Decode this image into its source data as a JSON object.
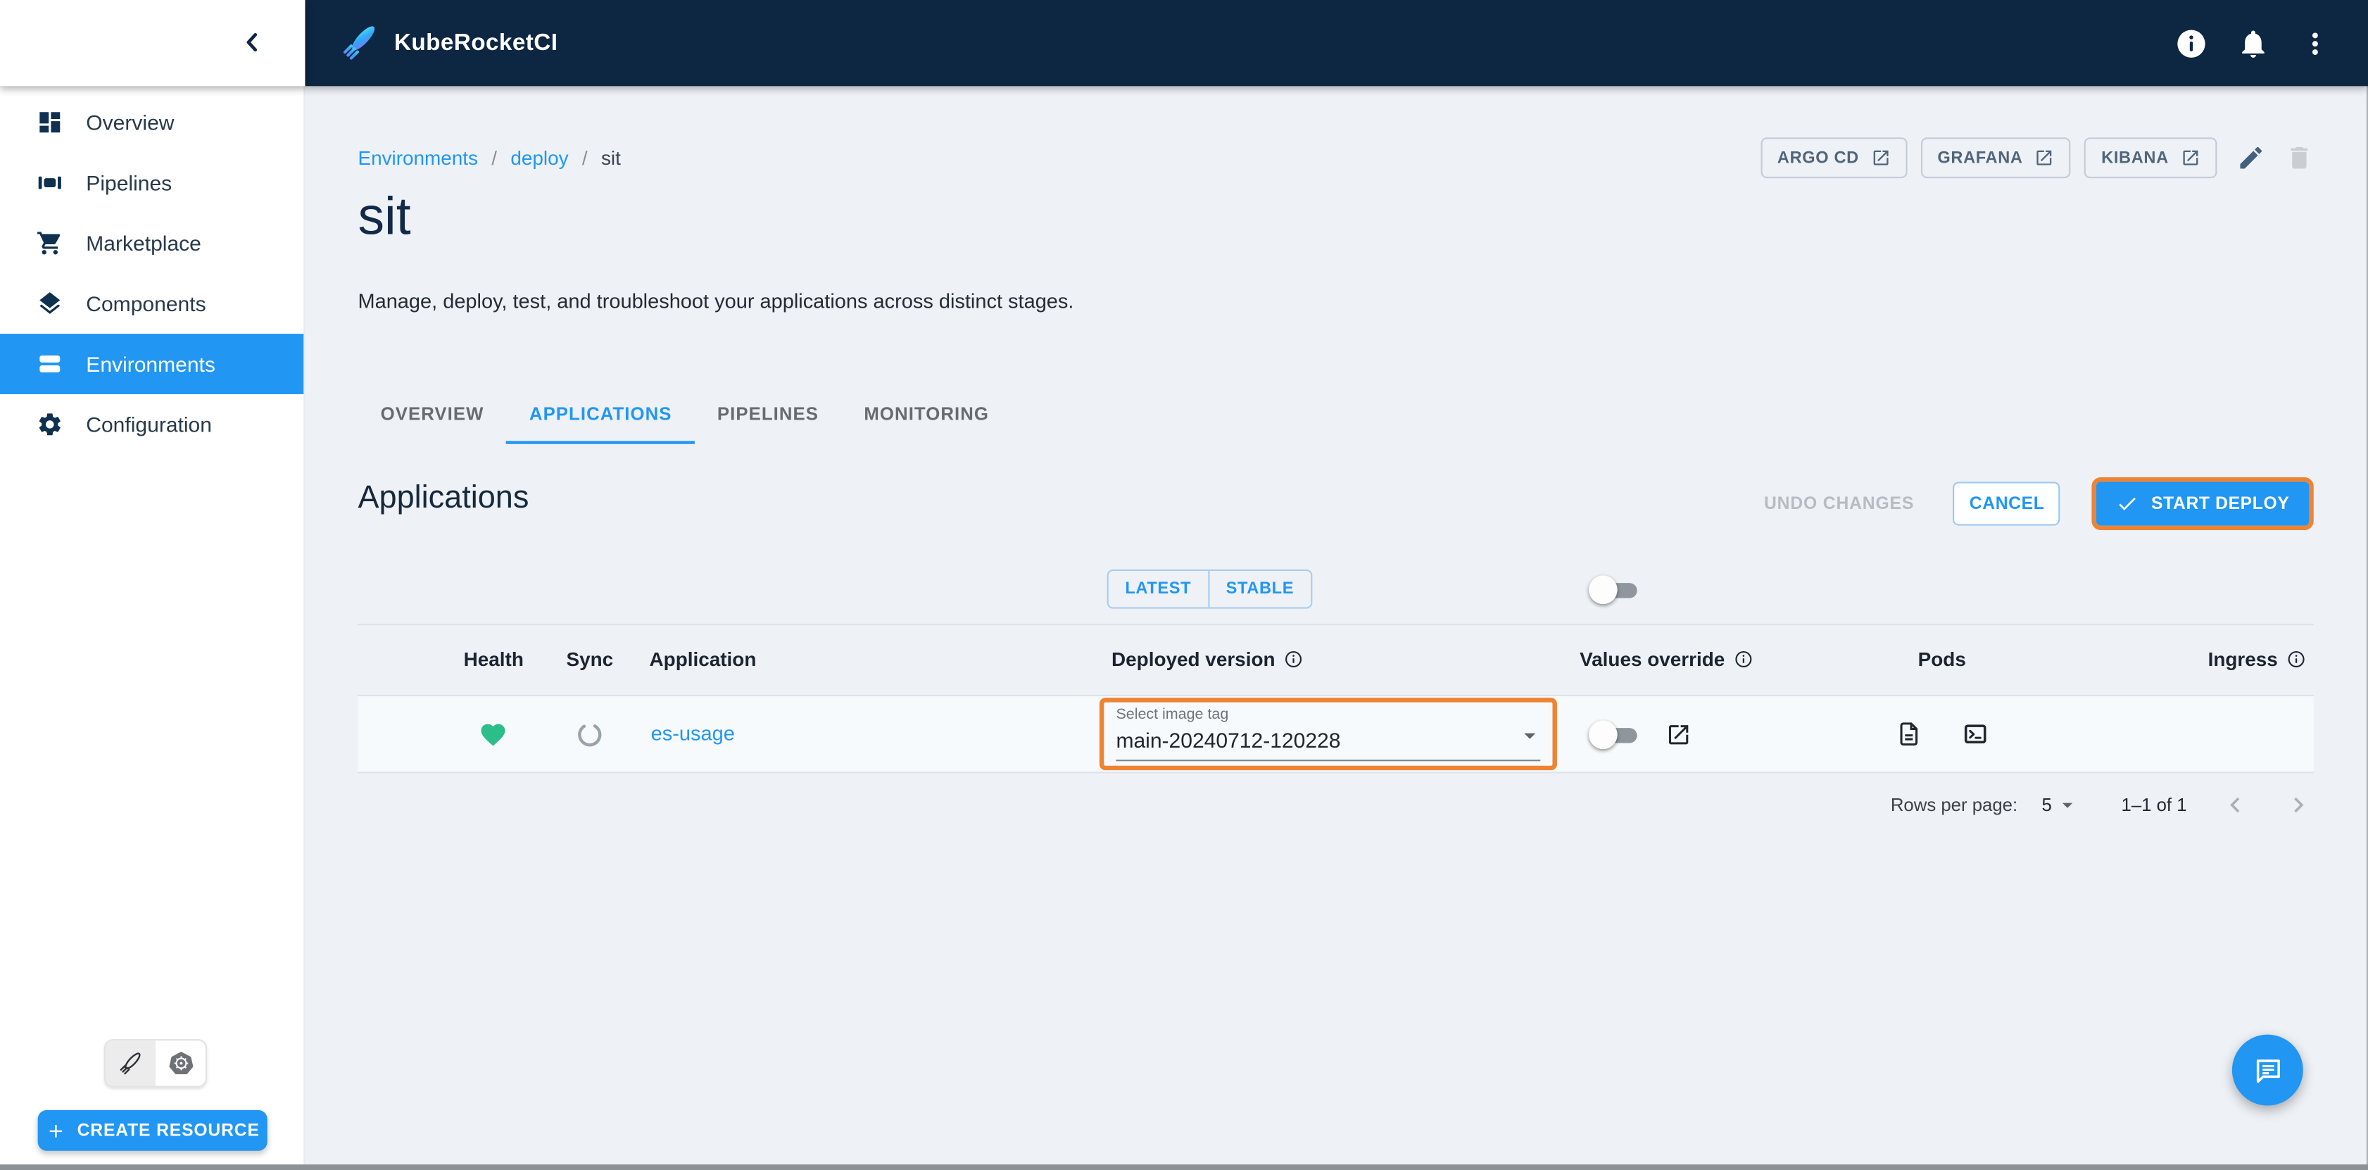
{
  "app_bar": {
    "title": "KubeRocketCI"
  },
  "sidebar": {
    "items": [
      {
        "label": "Overview"
      },
      {
        "label": "Pipelines"
      },
      {
        "label": "Marketplace"
      },
      {
        "label": "Components"
      },
      {
        "label": "Environments"
      },
      {
        "label": "Configuration"
      }
    ],
    "active_item": "Environments",
    "create_button_label": "CREATE RESOURCE"
  },
  "breadcrumb": {
    "separator": "/",
    "items": [
      {
        "label": "Environments"
      },
      {
        "label": "deploy"
      },
      {
        "label": "sit"
      }
    ]
  },
  "quick_links": {
    "argocd": "ARGO CD",
    "grafana": "GRAFANA",
    "kibana": "KIBANA"
  },
  "page": {
    "title": "sit",
    "description": "Manage, deploy, test, and troubleshoot your applications across distinct stages."
  },
  "tabs": {
    "active": "APPLICATIONS",
    "items": [
      {
        "label": "OVERVIEW"
      },
      {
        "label": "APPLICATIONS"
      },
      {
        "label": "PIPELINES"
      },
      {
        "label": "MONITORING"
      }
    ]
  },
  "applications": {
    "title": "Applications",
    "undo_label": "UNDO CHANGES",
    "cancel_label": "CANCEL",
    "deploy_label": "START DEPLOY",
    "filter": {
      "latest": "LATEST",
      "stable": "STABLE"
    }
  },
  "table": {
    "headers": {
      "health": "Health",
      "sync": "Sync",
      "application": "Application",
      "deployed_version": "Deployed version",
      "values_override": "Values override",
      "pods": "Pods",
      "ingress": "Ingress"
    },
    "rows": [
      {
        "application": "es-usage",
        "image_tag_label": "Select image tag",
        "image_tag": "main-20240712-120228"
      }
    ]
  },
  "pagination": {
    "rows_per_page_label": "Rows per page:",
    "rows_per_page_value": "5",
    "range_label": "1–1 of 1"
  },
  "colors": {
    "accent_blue": "#2196f3",
    "header_navy": "#0d2642",
    "highlight_orange": "#ee8433",
    "health_green": "#2bbe8b"
  }
}
